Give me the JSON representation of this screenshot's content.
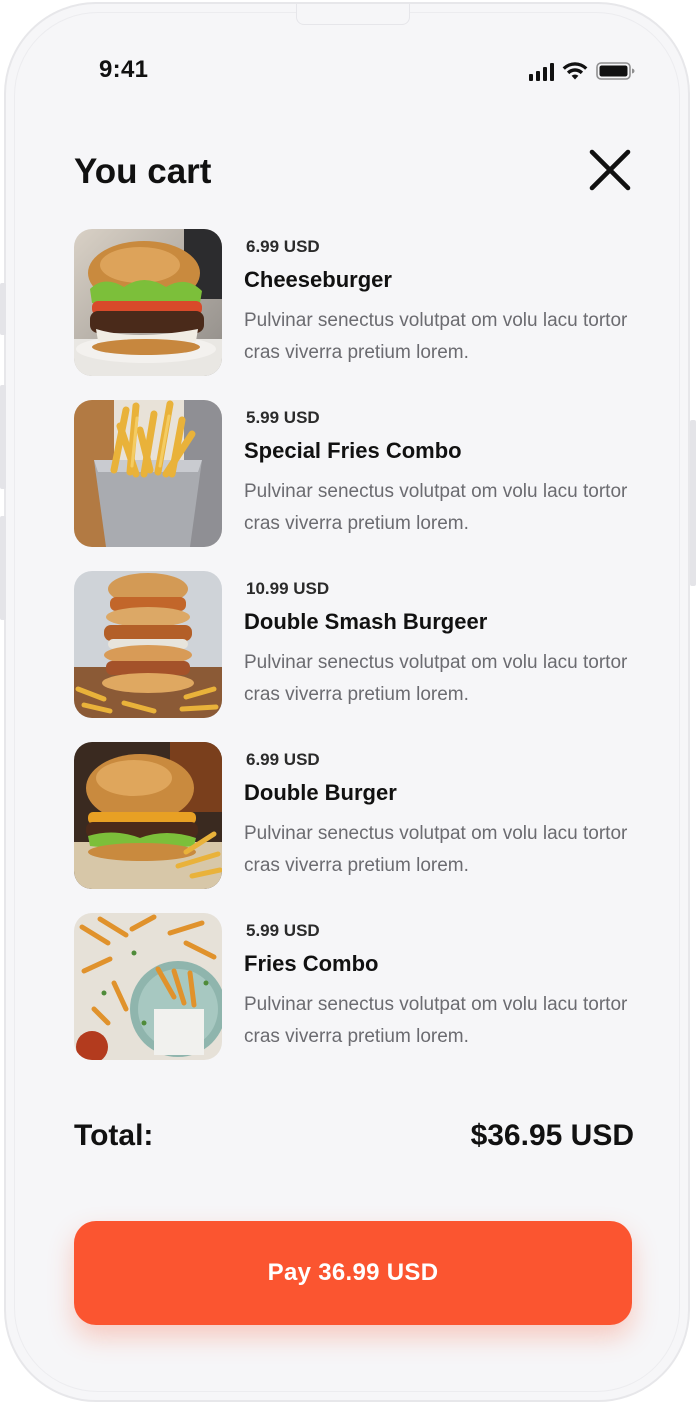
{
  "status_bar": {
    "time": "9:41",
    "icons": [
      "signal-icon",
      "wifi-icon",
      "battery-icon"
    ]
  },
  "header": {
    "title": "You cart",
    "close_icon": "close-icon"
  },
  "cart": {
    "items": [
      {
        "price": "6.99 USD",
        "name": "Cheeseburger",
        "description": "Pulvinar senectus volutpat om volu lacu tortor cras viverra pretium lorem.",
        "image": "cheeseburger-photo"
      },
      {
        "price": "5.99 USD",
        "name": "Special Fries Combo",
        "description": "Pulvinar senectus volutpat om volu lacu tortor cras viverra pretium lorem.",
        "image": "fries-bucket-photo"
      },
      {
        "price": "10.99 USD",
        "name": "Double Smash Burgeer",
        "description": "Pulvinar senectus volutpat om volu lacu tortor cras viverra pretium lorem.",
        "image": "stacked-burger-photo"
      },
      {
        "price": "6.99 USD",
        "name": "Double Burger",
        "description": "Pulvinar senectus volutpat om volu lacu tortor cras viverra pretium lorem.",
        "image": "double-burger-photo"
      },
      {
        "price": "5.99 USD",
        "name": "Fries Combo",
        "description": "Pulvinar senectus volutpat om volu lacu tortor cras viverra pretium lorem.",
        "image": "fries-platter-photo"
      }
    ]
  },
  "total": {
    "label": "Total:",
    "value": "$36.95 USD"
  },
  "pay_button": {
    "label": "Pay 36.99 USD"
  },
  "colors": {
    "accent": "#fb5530",
    "background": "#f6f6f8",
    "text_primary": "#111111",
    "text_secondary": "#6b6b70"
  }
}
